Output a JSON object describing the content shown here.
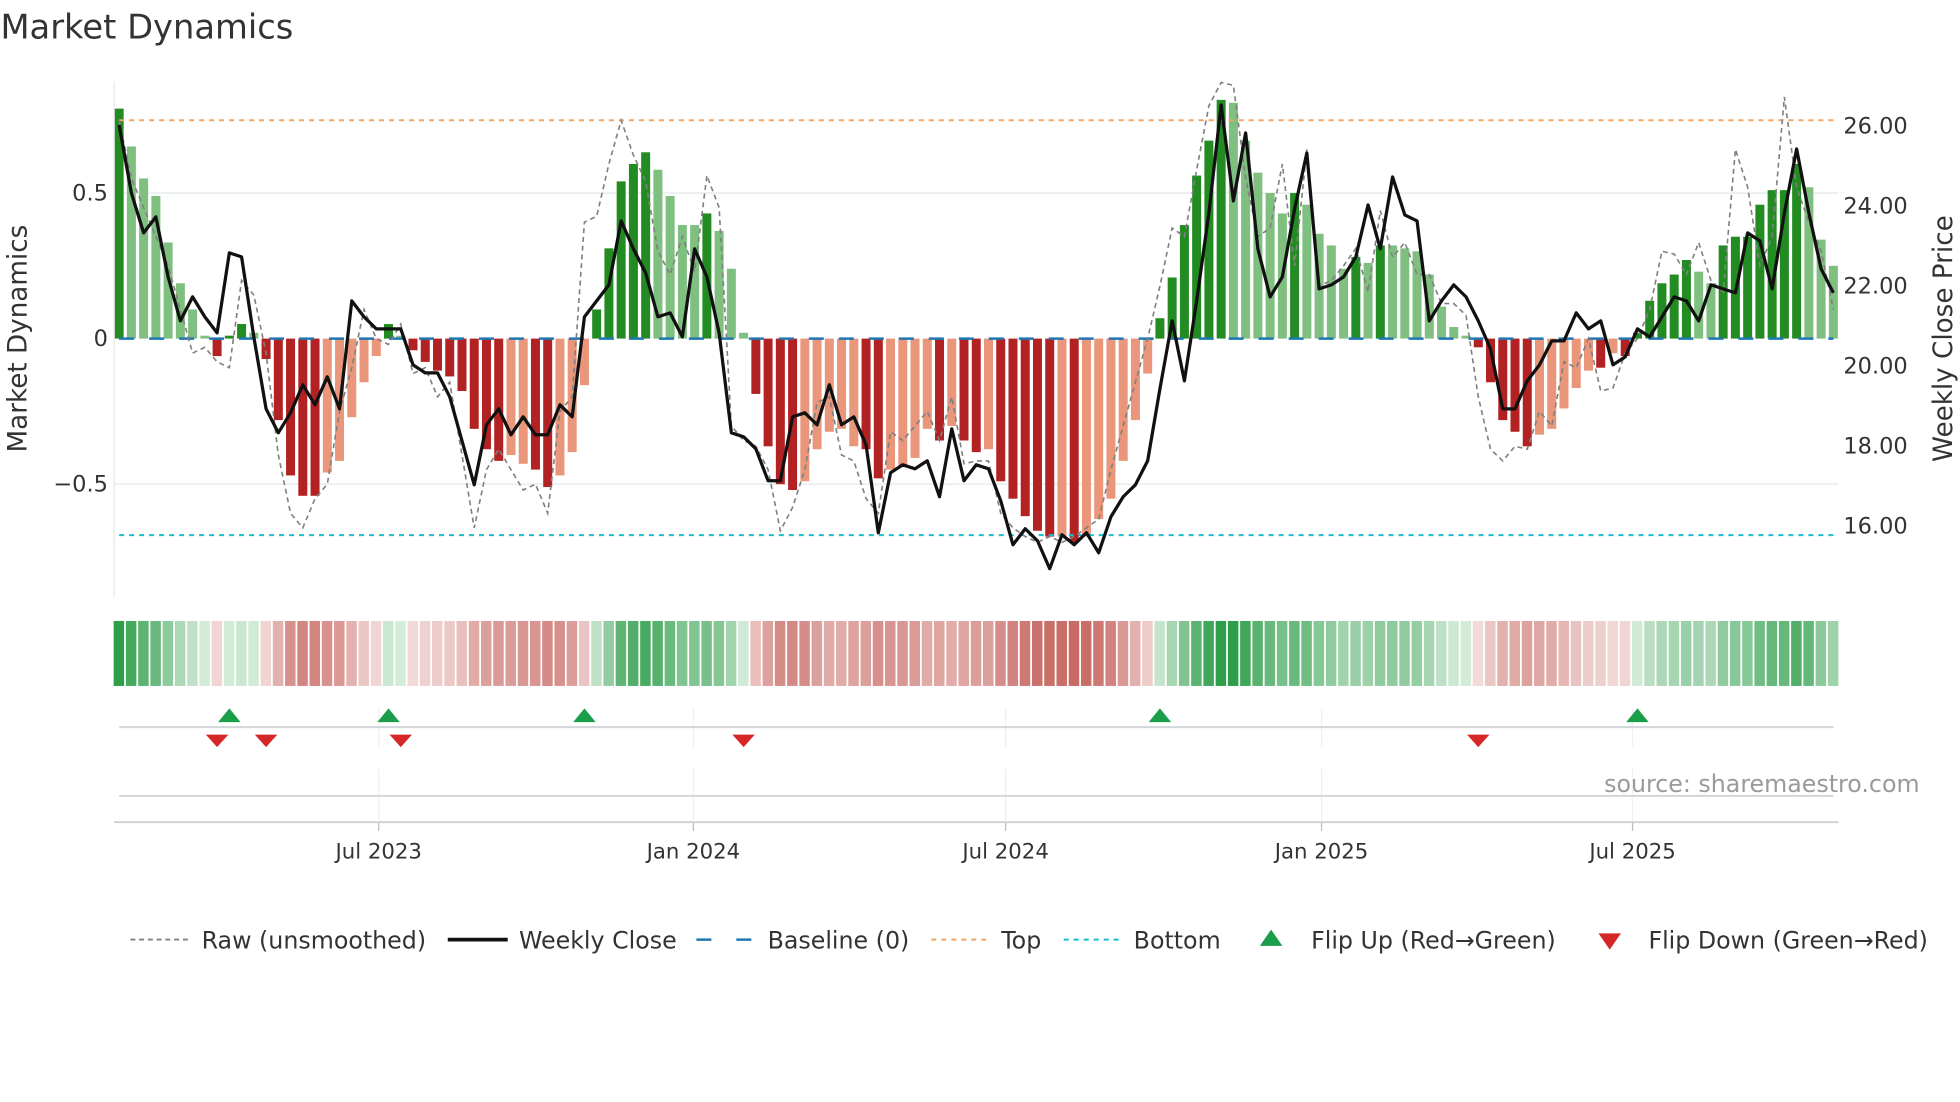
{
  "chart_data": {
    "type": "bar",
    "title": "Market Dynamics",
    "ylabel": "Market Dynamics",
    "y2label": "Weekly Close Price",
    "ylim": [
      -0.85,
      0.88
    ],
    "y2lim": [
      14.4,
      27.0
    ],
    "start_week": "2023-02-03",
    "yticks": [
      {
        "v": 0.5,
        "label": "0.5"
      },
      {
        "v": 0,
        "label": "0"
      },
      {
        "v": -0.5,
        "label": "−0.5"
      }
    ],
    "y2ticks": [
      {
        "v": 26,
        "label": "26.00"
      },
      {
        "v": 24,
        "label": "24.00"
      },
      {
        "v": 22,
        "label": "22.00"
      },
      {
        "v": 20,
        "label": "20.00"
      },
      {
        "v": 18,
        "label": "18.00"
      },
      {
        "v": 16,
        "label": "16.00"
      }
    ],
    "xticks": [
      {
        "week": 21.2,
        "label": "Jul 2023"
      },
      {
        "week": 46.9,
        "label": "Jan 2024"
      },
      {
        "week": 72.4,
        "label": "Jul 2024"
      },
      {
        "week": 98.2,
        "label": "Jan 2025"
      },
      {
        "week": 123.6,
        "label": "Jul 2025"
      }
    ],
    "top_level": 0.75,
    "bottom_level": -0.675,
    "baseline": 0,
    "momentum": [
      0.79,
      0.66,
      0.55,
      0.49,
      0.33,
      0.19,
      0.1,
      0.01,
      -0.06,
      0.01,
      0.05,
      0.02,
      -0.07,
      -0.28,
      -0.47,
      -0.54,
      -0.54,
      -0.46,
      -0.42,
      -0.27,
      -0.15,
      -0.06,
      0.05,
      0.01,
      -0.04,
      -0.08,
      -0.11,
      -0.13,
      -0.18,
      -0.31,
      -0.38,
      -0.42,
      -0.4,
      -0.43,
      -0.45,
      -0.51,
      -0.47,
      -0.39,
      -0.16,
      0.1,
      0.31,
      0.54,
      0.6,
      0.64,
      0.58,
      0.49,
      0.39,
      0.39,
      0.43,
      0.37,
      0.24,
      0.02,
      -0.19,
      -0.37,
      -0.5,
      -0.52,
      -0.49,
      -0.38,
      -0.32,
      -0.31,
      -0.37,
      -0.38,
      -0.48,
      -0.45,
      -0.44,
      -0.41,
      -0.31,
      -0.35,
      -0.3,
      -0.35,
      -0.39,
      -0.38,
      -0.49,
      -0.55,
      -0.61,
      -0.66,
      -0.68,
      -0.68,
      -0.7,
      -0.68,
      -0.62,
      -0.55,
      -0.42,
      -0.28,
      -0.12,
      0.07,
      0.21,
      0.39,
      0.56,
      0.68,
      0.82,
      0.81,
      0.68,
      0.57,
      0.5,
      0.43,
      0.5,
      0.46,
      0.36,
      0.32,
      0.24,
      0.28,
      0.26,
      0.32,
      0.32,
      0.31,
      0.3,
      0.22,
      0.11,
      0.04,
      0.01,
      -0.03,
      -0.15,
      -0.28,
      -0.32,
      -0.37,
      -0.33,
      -0.31,
      -0.24,
      -0.17,
      -0.11,
      -0.1,
      -0.05,
      -0.06,
      0.02,
      0.13,
      0.19,
      0.22,
      0.27,
      0.23,
      0.19,
      0.32,
      0.35,
      0.35,
      0.46,
      0.51,
      0.51,
      0.6,
      0.52,
      0.34,
      0.25
    ],
    "strong": [
      1,
      0,
      0,
      0,
      0,
      0,
      0,
      0,
      1,
      1,
      1,
      0,
      1,
      1,
      1,
      1,
      1,
      0,
      0,
      0,
      0,
      0,
      1,
      0,
      1,
      1,
      1,
      1,
      1,
      1,
      1,
      1,
      0,
      0,
      1,
      1,
      0,
      0,
      0,
      1,
      1,
      1,
      1,
      1,
      0,
      0,
      0,
      0,
      1,
      0,
      0,
      0,
      1,
      1,
      1,
      1,
      0,
      0,
      0,
      0,
      0,
      1,
      1,
      0,
      0,
      0,
      0,
      1,
      0,
      1,
      1,
      0,
      1,
      1,
      1,
      1,
      1,
      0,
      1,
      0,
      0,
      0,
      0,
      0,
      0,
      1,
      1,
      1,
      1,
      1,
      1,
      0,
      0,
      0,
      0,
      0,
      1,
      0,
      0,
      0,
      0,
      1,
      0,
      1,
      0,
      0,
      0,
      0,
      0,
      0,
      0,
      1,
      1,
      1,
      1,
      1,
      0,
      0,
      0,
      0,
      0,
      1,
      0,
      1,
      1,
      1,
      1,
      1,
      1,
      0,
      0,
      1,
      1,
      1,
      1,
      1,
      1,
      1,
      0,
      0,
      0
    ],
    "raw": [
      0.75,
      0.55,
      0.45,
      0.35,
      0.25,
      0.1,
      -0.05,
      -0.03,
      -0.08,
      -0.1,
      0.2,
      0.15,
      -0.05,
      -0.4,
      -0.6,
      -0.65,
      -0.55,
      -0.5,
      -0.25,
      -0.1,
      0.1,
      0,
      -0.02,
      0.05,
      -0.12,
      -0.1,
      -0.2,
      -0.15,
      -0.4,
      -0.65,
      -0.45,
      -0.38,
      -0.45,
      -0.52,
      -0.5,
      -0.6,
      -0.25,
      -0.2,
      0.4,
      0.42,
      0.6,
      0.75,
      0.63,
      0.54,
      0.3,
      0.22,
      0.35,
      0.23,
      0.56,
      0.45,
      -0.3,
      -0.35,
      -0.37,
      -0.45,
      -0.66,
      -0.58,
      -0.45,
      -0.22,
      -0.2,
      -0.4,
      -0.42,
      -0.55,
      -0.6,
      -0.32,
      -0.35,
      -0.3,
      -0.25,
      -0.35,
      -0.2,
      -0.43,
      -0.42,
      -0.42,
      -0.6,
      -0.65,
      -0.68,
      -0.7,
      -0.68,
      -0.7,
      -0.68,
      -0.65,
      -0.62,
      -0.45,
      -0.3,
      -0.15,
      0.0,
      0.18,
      0.38,
      0.35,
      0.58,
      0.8,
      0.88,
      0.87,
      0.55,
      0.35,
      0.38,
      0.6,
      0.25,
      0.65,
      0.18,
      0.2,
      0.25,
      0.31,
      0.16,
      0.44,
      0.28,
      0.33,
      0.22,
      0.22,
      0.12,
      0.12,
      0.08,
      -0.2,
      -0.38,
      -0.42,
      -0.37,
      -0.38,
      -0.25,
      -0.3,
      -0.08,
      -0.1,
      0.0,
      -0.18,
      -0.17,
      -0.05,
      0.0,
      0.1,
      0.3,
      0.29,
      0.22,
      0.33,
      0.2,
      0.16,
      0.65,
      0.52,
      0.25,
      0.35,
      0.83,
      0.52,
      0.4,
      0.3,
      0.1
    ],
    "weekly_close": [
      26.0,
      24.3,
      23.3,
      23.7,
      22.2,
      21.1,
      21.7,
      21.2,
      20.8,
      22.8,
      22.7,
      20.7,
      18.9,
      18.3,
      18.8,
      19.5,
      19.0,
      19.7,
      18.9,
      21.6,
      21.2,
      20.9,
      20.9,
      20.9,
      20.0,
      19.8,
      19.8,
      19.2,
      18.1,
      17.0,
      18.5,
      18.9,
      18.25,
      18.7,
      18.25,
      18.25,
      19.0,
      18.7,
      21.2,
      21.6,
      22.0,
      23.6,
      22.9,
      22.3,
      21.2,
      21.3,
      20.7,
      22.9,
      22.2,
      20.8,
      18.3,
      18.2,
      17.9,
      17.1,
      17.1,
      18.7,
      18.8,
      18.5,
      19.5,
      18.5,
      18.7,
      18.0,
      15.8,
      17.3,
      17.5,
      17.4,
      17.6,
      16.7,
      18.4,
      17.1,
      17.5,
      17.4,
      16.6,
      15.5,
      15.9,
      15.6,
      14.9,
      15.75,
      15.5,
      15.8,
      15.3,
      16.2,
      16.7,
      17.0,
      17.6,
      19.4,
      21.1,
      19.6,
      21.6,
      23.8,
      26.5,
      24.1,
      25.8,
      22.9,
      21.7,
      22.2,
      23.9,
      25.3,
      21.9,
      22.0,
      22.2,
      22.7,
      24.0,
      22.9,
      24.7,
      23.75,
      23.6,
      21.1,
      21.6,
      22.0,
      21.7,
      21.1,
      20.4,
      18.9,
      18.9,
      19.6,
      20.0,
      20.6,
      20.6,
      21.3,
      20.9,
      21.1,
      20.0,
      20.2,
      20.9,
      20.7,
      21.2,
      21.7,
      21.6,
      21.1,
      22.0,
      21.9,
      21.8,
      23.3,
      23.1,
      21.9,
      23.8,
      25.4,
      23.8,
      22.4,
      21.8
    ],
    "flip_up_weeks": [
      9,
      22,
      38,
      85,
      124
    ],
    "flip_down_weeks": [
      8,
      12,
      23,
      51,
      111
    ],
    "legend": {
      "placement": "bottom",
      "items": [
        {
          "key": "raw",
          "label": "Raw (unsmoothed)"
        },
        {
          "key": "close",
          "label": "Weekly Close"
        },
        {
          "key": "baseline",
          "label": "Baseline (0)"
        },
        {
          "key": "top",
          "label": "Top"
        },
        {
          "key": "bottom",
          "label": "Bottom"
        },
        {
          "key": "flip_up",
          "label": "Flip Up (Red→Green)"
        },
        {
          "key": "flip_down",
          "label": "Flip Down (Green→Red)"
        }
      ]
    },
    "source": "source: sharemaestro.com",
    "colors": {
      "strong_green": "#228b22",
      "weak_green": "#7fbf7f",
      "strong_red": "#b22222",
      "weak_red": "#e9967a",
      "heat_green": "#2e9e4a",
      "heat_red": "#c5605a",
      "baseline": "#1f77b4",
      "top": "#f4a460",
      "bottom": "#17becf",
      "raw": "#808080",
      "close": "#111111",
      "flip_up": "#1a9e4a",
      "flip_down": "#d62728"
    }
  }
}
